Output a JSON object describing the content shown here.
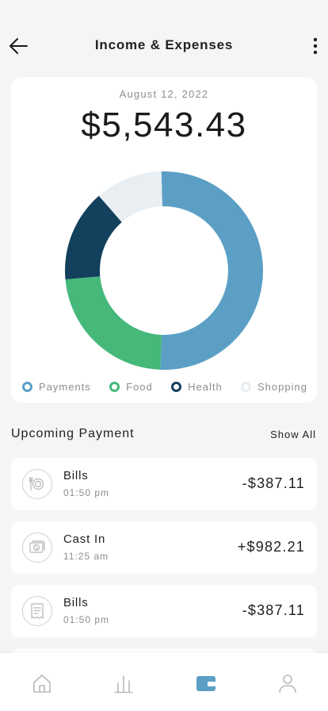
{
  "header": {
    "title": "Income & Expenses"
  },
  "summary": {
    "date": "August 12, 2022",
    "amount": "$5,543.43"
  },
  "legend": [
    {
      "label": "Payments",
      "color": "#5b9fc5"
    },
    {
      "label": "Food",
      "color": "#45b87a"
    },
    {
      "label": "Health",
      "color": "#12405d"
    },
    {
      "label": "Shopping",
      "color": "#e8eef2"
    }
  ],
  "donut_segments": [
    {
      "name": "Payments",
      "share": 0.51,
      "color": "#5b9fc5"
    },
    {
      "name": "Food",
      "share": 0.23,
      "color": "#45b87a"
    },
    {
      "name": "Health",
      "share": 0.15,
      "color": "#12405d"
    },
    {
      "name": "Shopping",
      "share": 0.11,
      "color": "#e8eef2"
    }
  ],
  "upcoming": {
    "title": "Upcoming Payment",
    "show_all": "Show All",
    "items": [
      {
        "name": "Bills",
        "time": "01:50 pm",
        "amount": "-$387.11",
        "icon": "dining-icon"
      },
      {
        "name": "Cast In",
        "time": "11:25 am",
        "amount": "+$982.21",
        "icon": "cash-icon"
      },
      {
        "name": "Bills",
        "time": "01:50 pm",
        "amount": "-$387.11",
        "icon": "receipt-icon"
      }
    ]
  },
  "tabbar": {
    "tabs": [
      {
        "icon": "home-icon",
        "active": false
      },
      {
        "icon": "stats-icon",
        "active": false
      },
      {
        "icon": "wallet-icon",
        "active": true
      },
      {
        "icon": "profile-icon",
        "active": false
      }
    ],
    "active_color": "#5b9fc5",
    "inactive_color": "#b9b9b9"
  }
}
